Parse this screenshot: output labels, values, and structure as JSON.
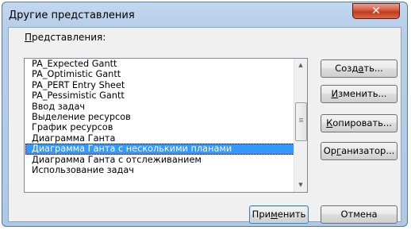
{
  "window": {
    "title": "Другие представления",
    "close_glyph": "✕"
  },
  "list": {
    "label_underlined": "П",
    "label_rest": "редставления:",
    "items": [
      "PA_Expected Gantt",
      "PA_Optimistic Gantt",
      "PA_PERT Entry Sheet",
      "PA_Pessimistic Gantt",
      "Ввод задач",
      "Выделение ресурсов",
      "График ресурсов",
      "Диаграмма Ганта",
      "Диаграмма Ганта с несколькими планами",
      "Диаграмма Ганта с отслеживанием",
      "Использование задач"
    ],
    "selected_index": 8
  },
  "buttons": {
    "create": {
      "pre": "Созд",
      "u": "а",
      "post": "ть..."
    },
    "edit": {
      "pre": "",
      "u": "И",
      "post": "зменить..."
    },
    "copy": {
      "pre": "",
      "u": "К",
      "post": "опировать..."
    },
    "organizer": {
      "pre": "Ор",
      "u": "г",
      "post": "анизатор..."
    },
    "apply": {
      "pre": "При",
      "u": "м",
      "post": "енить"
    },
    "cancel": {
      "label": "Отмена"
    }
  },
  "icons": {
    "scroll_up": "▲",
    "scroll_down": "▼"
  },
  "colors": {
    "selection": "#3399ff",
    "title_bar": "#b7cfea",
    "close_button": "#c13a1c"
  }
}
